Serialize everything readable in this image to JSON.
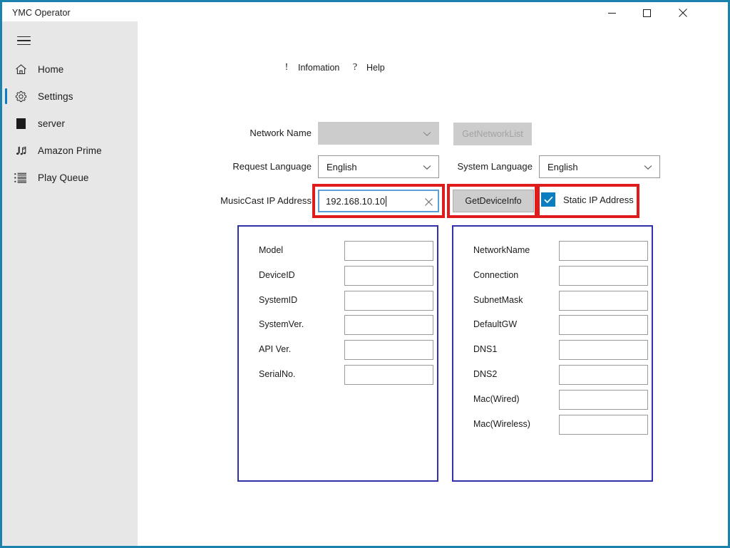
{
  "window": {
    "title": "YMC Operator",
    "controls": {
      "minimize": "minimize",
      "maximize": "maximize",
      "close": "close"
    }
  },
  "sidebar": {
    "menu_icon": "hamburger-icon",
    "items": [
      {
        "label": "Home",
        "icon": "home-icon",
        "selected": false
      },
      {
        "label": "Settings",
        "icon": "gear-icon",
        "selected": true
      },
      {
        "label": "server",
        "icon": "square-icon",
        "selected": false
      },
      {
        "label": "Amazon Prime",
        "icon": "music-note-icon",
        "selected": false
      },
      {
        "label": "Play Queue",
        "icon": "list-icon",
        "selected": false
      }
    ]
  },
  "toolbar": {
    "information": {
      "label": "Infomation",
      "glyph": "!",
      "icon": "exclamation-icon"
    },
    "help": {
      "label": "Help",
      "glyph": "?",
      "icon": "question-icon"
    }
  },
  "form": {
    "network_name": {
      "label": "Network Name",
      "value": "",
      "disabled": true
    },
    "get_network_list": {
      "label": "GetNetworkList",
      "disabled": true
    },
    "request_language": {
      "label": "Request Language",
      "value": "English",
      "options": [
        "English"
      ]
    },
    "system_language": {
      "label": "System Language",
      "value": "English",
      "options": [
        "English"
      ]
    },
    "musiccast_ip": {
      "label": "MusicCast IP Address",
      "value": "192.168.10.10",
      "clear_icon": "clear-icon"
    },
    "get_device_info": {
      "label": "GetDeviceInfo"
    },
    "static_ip": {
      "label": "Static IP Address",
      "checked": true
    }
  },
  "device_panel": {
    "rows": [
      {
        "label": "Model",
        "value": ""
      },
      {
        "label": "DeviceID",
        "value": ""
      },
      {
        "label": "SystemID",
        "value": ""
      },
      {
        "label": "SystemVer.",
        "value": ""
      },
      {
        "label": "API Ver.",
        "value": ""
      },
      {
        "label": "SerialNo.",
        "value": ""
      }
    ]
  },
  "network_panel": {
    "rows": [
      {
        "label": "NetworkName",
        "value": ""
      },
      {
        "label": "Connection",
        "value": ""
      },
      {
        "label": "SubnetMask",
        "value": ""
      },
      {
        "label": "DefaultGW",
        "value": ""
      },
      {
        "label": "DNS1",
        "value": ""
      },
      {
        "label": "DNS2",
        "value": ""
      },
      {
        "label": "Mac(Wired)",
        "value": ""
      },
      {
        "label": "Mac(Wireless)",
        "value": ""
      }
    ]
  },
  "colors": {
    "window_frame": "#1a82ad",
    "sidebar_bg": "#e7e7e7",
    "selection_accent": "#0a7ec0",
    "checkbox_fill": "#0a7ec0",
    "panel_border": "#3030a8",
    "annotation_red": "#e01b1b",
    "focus_border": "#5c9fd6",
    "disabled_bg": "#cccccc",
    "button_bg": "#cdcdcd"
  }
}
